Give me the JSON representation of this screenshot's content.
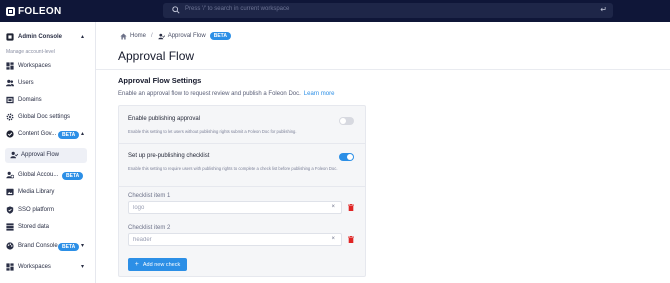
{
  "app": {
    "logo_text": "FOLEON"
  },
  "search": {
    "placeholder": "Press '/' to search in current workspace",
    "enter_icon": "enter-icon",
    "search_icon": "search-icon"
  },
  "sidebar": {
    "header": {
      "label": "Admin Console",
      "icon": "admin-console-icon",
      "chevron": "▴"
    },
    "section_label": "Manage account-level",
    "items": [
      {
        "label": "Workspaces",
        "icon": "workspaces-icon"
      },
      {
        "label": "Users",
        "icon": "users-icon"
      },
      {
        "label": "Domains",
        "icon": "domains-icon"
      },
      {
        "label": "Global Doc settings",
        "icon": "gear-icon"
      },
      {
        "label": "Content Gov...",
        "icon": "content-governance-icon",
        "badge": "BETA",
        "chevron": "▴"
      },
      {
        "label": "Approval Flow",
        "icon": "approval-flow-icon",
        "active": true
      },
      {
        "label": "Global Accou...",
        "icon": "global-account-icon",
        "badge": "BETA"
      },
      {
        "label": "Media Library",
        "icon": "media-library-icon"
      },
      {
        "label": "SSO platform",
        "icon": "shield-icon"
      },
      {
        "label": "Stored data",
        "icon": "stored-data-icon"
      },
      {
        "label": "Brand Console",
        "icon": "brand-console-icon",
        "badge": "BETA",
        "chevron": "▾"
      },
      {
        "label": "Workspaces",
        "icon": "workspaces-icon",
        "chevron": "▾"
      }
    ]
  },
  "breadcrumb": {
    "home": "Home",
    "separator": "/",
    "current": "Approval Flow",
    "badge": "BETA"
  },
  "page": {
    "title": "Approval Flow"
  },
  "settings": {
    "title": "Approval Flow Settings",
    "description": "Enable an approval flow to request review and publish a Foleon Doc.",
    "learn_more": "Learn more",
    "publishing": {
      "title": "Enable publishing approval",
      "description": "Enable this setting to let users without publishing rights submit a Foleon Doc for publishing.",
      "enabled": false
    },
    "checklist": {
      "title": "Set up pre-publishing checklist",
      "description": "Enable this setting to require users with publishing rights to complete a check list before publishing a Foleon Doc.",
      "enabled": true
    },
    "items": [
      {
        "label": "Checklist item 1",
        "value": "",
        "placeholder": "logo",
        "clear": "×"
      },
      {
        "label": "Checklist item 2",
        "value": "",
        "placeholder": "header",
        "clear": "×"
      }
    ],
    "add_button": {
      "label": "Add new check",
      "icon": "+"
    }
  },
  "colors": {
    "topbar": "#0f1638",
    "accent": "#2c8fe6",
    "danger": "#e02424"
  }
}
